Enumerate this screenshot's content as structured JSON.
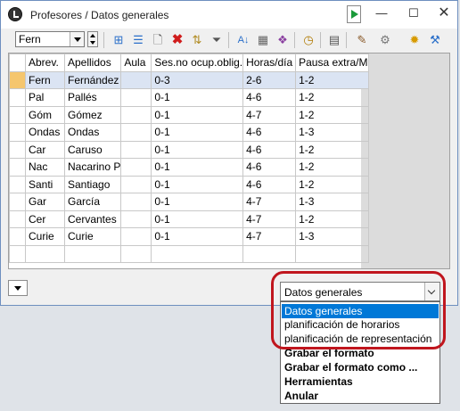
{
  "window": {
    "title": "Profesores / Datos generales",
    "controls": {
      "minimize": "—",
      "maximize": "☐",
      "close": "✕"
    }
  },
  "toolbar": {
    "combo_value": "Fern",
    "buttons": [
      "grid-icon",
      "columns-icon",
      "new-icon",
      "delete-icon",
      "sort-icon",
      "filter-icon",
      "sort-alpha-icon",
      "fields-icon",
      "gears-icon",
      "clock-icon",
      "calendar-icon",
      "brush-icon",
      "settings-gear-icon",
      "star-gear-icon",
      "wrench-icon"
    ]
  },
  "grid": {
    "columns": [
      "Abrev.",
      "Apellidos",
      "Aula",
      "Ses.no ocup.oblig.",
      "Horas/día",
      "Pausa extra/M"
    ],
    "rows": [
      [
        "Fern",
        "Fernández",
        "",
        "0-3",
        "2-6",
        "1-2"
      ],
      [
        "Pal",
        "Pallés",
        "",
        "0-1",
        "4-6",
        "1-2"
      ],
      [
        "Góm",
        "Gómez",
        "",
        "0-1",
        "4-7",
        "1-2"
      ],
      [
        "Ondas",
        "Ondas",
        "",
        "0-1",
        "4-6",
        "1-3"
      ],
      [
        "Car",
        "Caruso",
        "",
        "0-1",
        "4-6",
        "1-2"
      ],
      [
        "Nac",
        "Nacarino P",
        "",
        "0-1",
        "4-6",
        "1-2"
      ],
      [
        "Santi",
        "Santiago",
        "",
        "0-1",
        "4-6",
        "1-2"
      ],
      [
        "Gar",
        "García",
        "",
        "0-1",
        "4-7",
        "1-3"
      ],
      [
        "Cer",
        "Cervantes",
        "",
        "0-1",
        "4-7",
        "1-2"
      ],
      [
        "Curie",
        "Curie",
        "",
        "0-1",
        "4-7",
        "1-3"
      ],
      [
        "",
        "",
        "",
        "",
        "",
        ""
      ]
    ]
  },
  "view_selector": {
    "value": "Datos generales",
    "options": [
      "Datos generales",
      "planificación de horarios",
      "planificación de representación",
      "Grabar el formato",
      "Grabar el formato como ...",
      "Herramientas",
      "Anular"
    ]
  },
  "colors": {
    "highlight_ring": "#c0161e",
    "selection_blue": "#0078d7"
  }
}
